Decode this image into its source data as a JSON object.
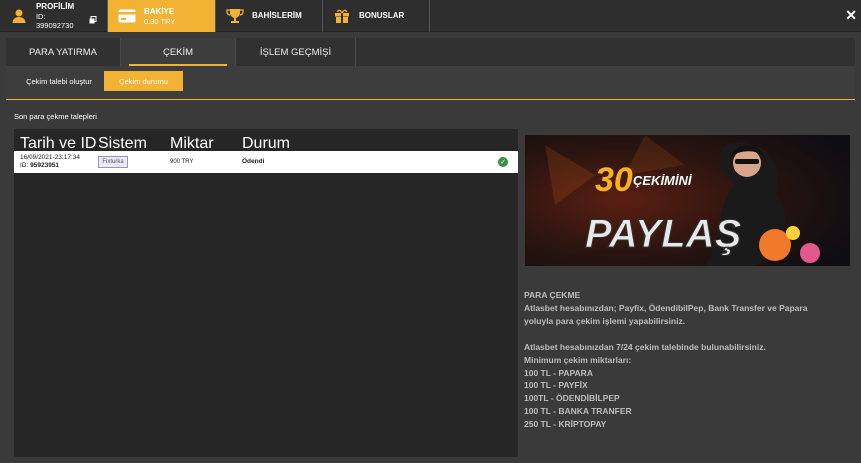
{
  "topbar": {
    "profile": {
      "title": "PROFİLİM",
      "id_text": "ID: 399092730"
    },
    "balance": {
      "title": "BAKİYE",
      "amount": "0.30 TRY"
    },
    "bets": {
      "title": "BAHİSLERİM"
    },
    "bonuses": {
      "title": "BONUSLAR"
    },
    "close": "✕"
  },
  "tabs": [
    "PARA YATIRMA",
    "ÇEKİM",
    "İŞLEM GEÇMİŞİ"
  ],
  "subtabs": [
    "Çekim talebi oluştur",
    "Çekim durumu"
  ],
  "section_title": "Son para çekme talepleri",
  "table": {
    "headers": [
      "Tarih ve ID",
      "Sistem",
      "Miktar",
      "Durum"
    ],
    "rows": [
      {
        "date": "16/09/2021-23:17:34",
        "id_label": "ID: ",
        "id": "95923951",
        "system": "Fixturka",
        "amount": "900 TRY",
        "status": "Ödendi"
      }
    ]
  },
  "banner": {
    "number": "30",
    "line1": "ÇEKİMİNİ",
    "line2": "PAYLAŞ"
  },
  "info": {
    "title": "PARA ÇEKME",
    "line1": "Atlasbet hesabınızdan; Payfix, ÖdendibilPep, Bank Transfer ve Papara",
    "line2": "yoluyla para çekim işlemi yapabilirsiniz.",
    "line3": "Atlasbet hesabınızdan 7/24 çekim talebinde bulunabilirsiniz.",
    "line4": "Minimum çekim miktarları:",
    "limits": [
      "100 TL - PAPARA",
      "100 TL - PAYFİX",
      "100TL - ÖDENDİBİLPEP",
      "100 TL - BANKA TRANFER",
      "250 TL - KRİPTOPAY"
    ]
  },
  "colors": {
    "accent": "#f2b233",
    "success": "#3e8e41"
  }
}
